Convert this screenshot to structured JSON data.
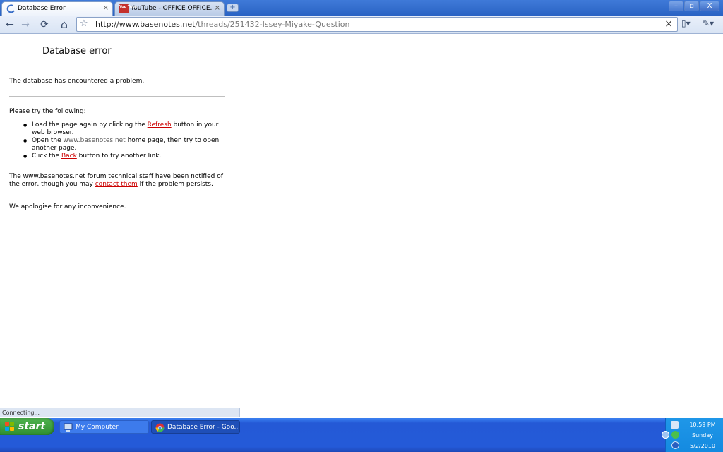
{
  "tabs": [
    {
      "title": "Database Error"
    },
    {
      "title": "YouTube - OFFICE OFFICE..."
    }
  ],
  "tab_close_glyph": "×",
  "new_tab_glyph": "+",
  "window_controls": {
    "minimize": "–",
    "maximize": "▫",
    "close": "X"
  },
  "toolbar": {
    "back_glyph": "←",
    "forward_glyph": "→",
    "reload_glyph": "⟳",
    "home_glyph": "⌂",
    "star_glyph": "☆",
    "clear_glyph": "×",
    "page_menu_glyph": "▯▾",
    "wrench_menu_glyph": "✎▾"
  },
  "address": {
    "host": "http://www.basenotes.net",
    "path": "/threads/251432-Issey-Miyake-Question"
  },
  "youtube_favicon_text": "You Tube",
  "page": {
    "title": "Database error",
    "intro": "The database has encountered a problem.",
    "try_heading": "Please try the following:",
    "bullets": [
      {
        "before": "Load the page again by clicking the ",
        "link": "Refresh",
        "after": " button in your web browser."
      },
      {
        "before": "Open the ",
        "link": "www.basenotes.net",
        "after": " home page, then try to open another page."
      },
      {
        "before": "Click the ",
        "link": "Back",
        "after": " button to try another link."
      }
    ],
    "notified_before": "The www.basenotes.net forum technical staff have been notified of the error, though you may ",
    "notified_link": "contact them",
    "notified_after": " if the problem persists.",
    "apology": "We apologise for any inconvenience."
  },
  "status_text": "Connecting...",
  "taskbar": {
    "start_label": "start",
    "items": [
      {
        "label": "My Computer"
      },
      {
        "label": "Database Error - Goo..."
      }
    ],
    "clock": {
      "time": "10:59 PM",
      "day": "Sunday",
      "date": "5/2/2010"
    }
  },
  "colors": {
    "link": "#cc0000",
    "taskbar": "#245ad8",
    "start": "#2f8f2f",
    "tray": "#148ae0"
  }
}
